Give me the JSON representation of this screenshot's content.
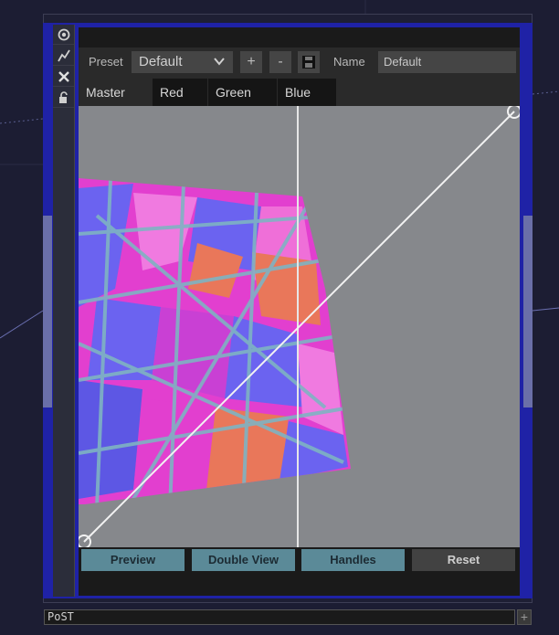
{
  "toolbar": {
    "icons": [
      "target-icon",
      "graph-icon",
      "close-icon",
      "lock-icon"
    ]
  },
  "preset": {
    "label": "Preset",
    "value": "Default",
    "add_label": "+",
    "remove_label": "-",
    "save_icon": "save-icon"
  },
  "name": {
    "label": "Name",
    "value": "Default"
  },
  "tabs": [
    "Master",
    "Red",
    "Green",
    "Blue"
  ],
  "active_tab": "Master",
  "buttons": {
    "preview": "Preview",
    "double_view": "Double View",
    "handles": "Handles",
    "reset": "Reset"
  },
  "footer": {
    "node_name": "PoST",
    "add_label": "+"
  },
  "colors": {
    "node_border": "#1f22a6",
    "button_teal": "#5b8a98",
    "viewport_bg": "#86888c",
    "mosaic_pink": "#e23fcf",
    "mosaic_blue": "#6b63f0",
    "mosaic_orange": "#e9775a"
  }
}
